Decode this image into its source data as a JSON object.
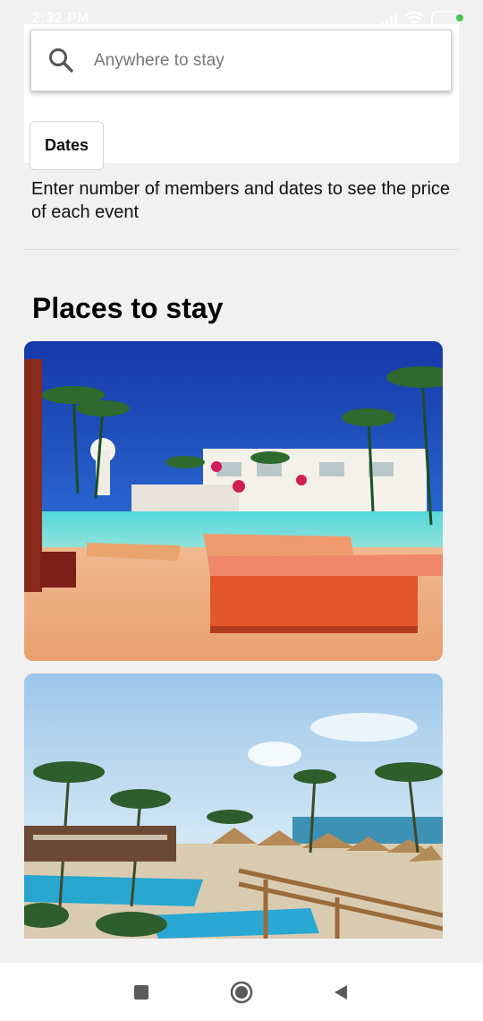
{
  "status_bar": {
    "time": "2:32 PM"
  },
  "search": {
    "placeholder": "Anywhere to stay",
    "icon": "search-icon"
  },
  "filters": {
    "dates_label": "Dates"
  },
  "info_text": "Enter number of members and dates to see the price of each event",
  "section": {
    "title": "Places to stay"
  },
  "cards": [
    {
      "image": "resort-pool-with-orange-loungers"
    },
    {
      "image": "beach-resort-with-palm-trees-and-thatched-umbrellas"
    }
  ],
  "nav": {
    "recent": "square-icon",
    "home": "circle-icon",
    "back": "triangle-back-icon"
  },
  "colors": {
    "background": "#f1f1f1",
    "card_bg": "#ffffff",
    "battery_dot": "#37c337"
  }
}
